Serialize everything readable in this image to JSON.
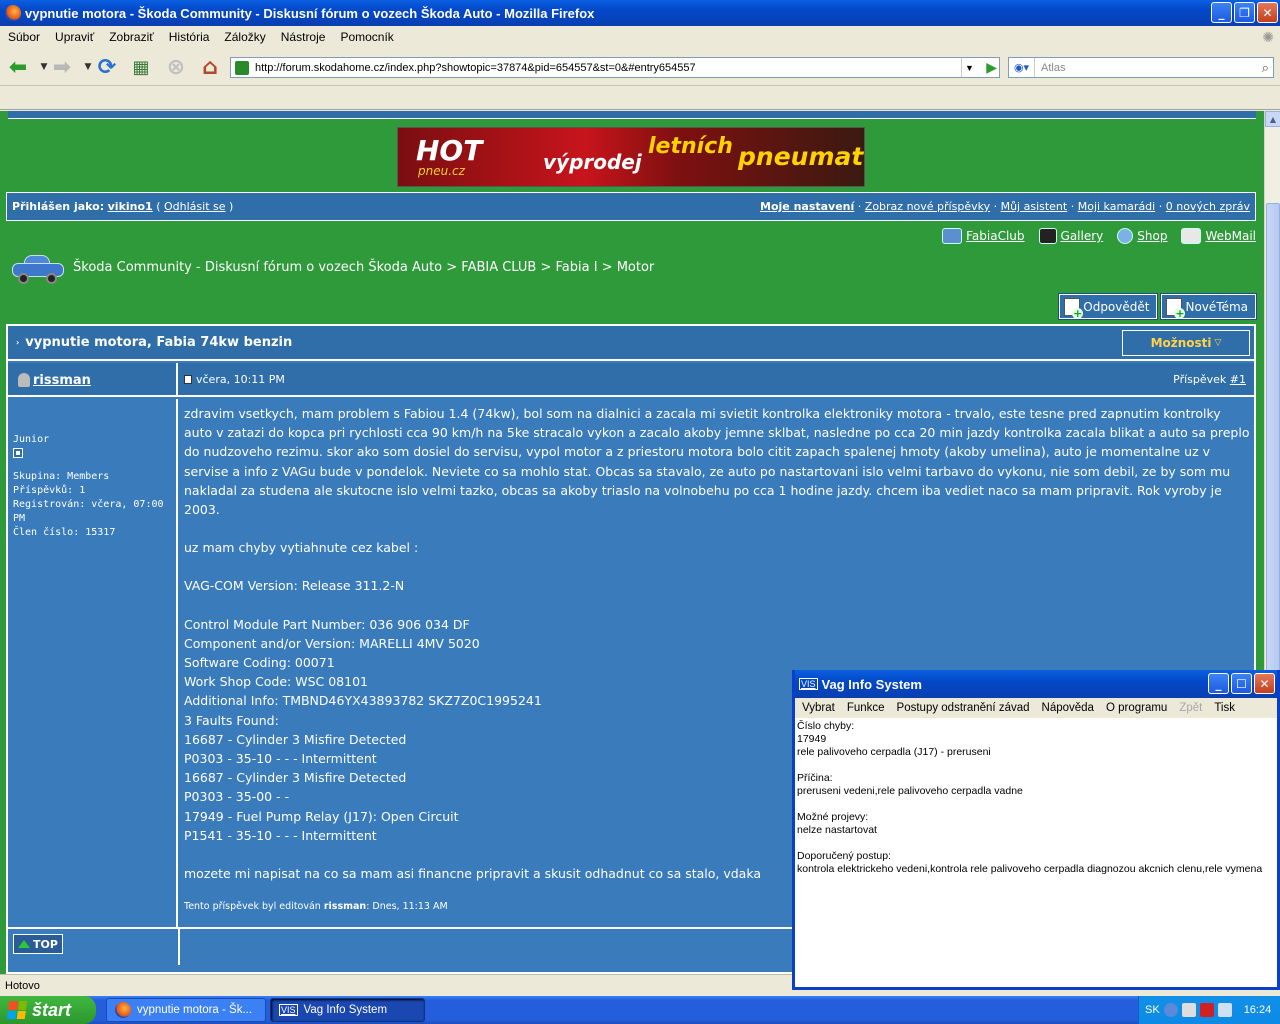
{
  "browser": {
    "title": "vypnutie motora - Škoda Community - Diskusní fórum o vozech Škoda Auto - Mozilla Firefox",
    "menu": [
      "Súbor",
      "Upraviť",
      "Zobraziť",
      "História",
      "Záložky",
      "Nástroje",
      "Pomocník"
    ],
    "url": "http://forum.skodahome.cz/index.php?showtopic=37874&pid=654557&st=0&#entry654557",
    "search_placeholder": "Atlas",
    "status": "Hotovo"
  },
  "banner": {
    "hot": "HOT",
    "pneu": "pneu.cz",
    "vyprodej": "výprodej",
    "letnich": "letních",
    "pneumatik": "pneumatik"
  },
  "login": {
    "prefix": "Přihlášen jako:",
    "user": "vikino1",
    "open": "(",
    "logout": "Odhlásit se",
    "close": ")",
    "links": [
      "Moje nastavení",
      "Zobraz nové příspěvky",
      "Můj asistent",
      "Moji kamarádi",
      "0 nových zpráv"
    ]
  },
  "quicklinks": [
    "FabiaClub",
    "Gallery",
    "Shop",
    "WebMail"
  ],
  "breadcrumb": "Škoda Community - Diskusní fórum o vozech Škoda Auto > FABIA CLUB > Fabia I > Motor",
  "actions": {
    "reply": "Odpovědět",
    "new_topic": "NovéTéma"
  },
  "topic": {
    "title": "vypnutie motora, Fabia 74kw benzin",
    "options": "Možnosti"
  },
  "post": {
    "author": "rissman",
    "date": "včera, 10:11 PM",
    "number_label": "Příspěvek",
    "number_link": "#1",
    "rank": "Junior",
    "info": [
      "Skupina: Members",
      "Příspěvků: 1",
      "Registrován: včera, 07:00 PM",
      "Člen číslo: 15317"
    ],
    "paragraphs": [
      "zdravim vsetkych, mam problem s Fabiou 1.4 (74kw), bol som na dialnici a zacala mi svietit kontrolka elektroniky motora - trvalo, este tesne pred zapnutim kontrolky auto v zatazi do kopca pri rychlosti cca 90 km/h na 5ke stracalo vykon a zacalo akoby jemne sklbat, nasledne po cca 20 min jazdy kontrolka zacala blikat a auto sa preplo do nudzoveho rezimu. skor ako som dosiel do servisu, vypol motor a z priestoru motora bolo citit zapach spalenej hmoty (akoby umelina), auto je momentalne uz v servise a info z VAGu bude v pondelok. Neviete co sa mohlo stat. Obcas sa stavalo, ze auto po nastartovani islo velmi tarbavo do vykonu, nie som debil, ze by som mu nakladal za studena ale skutocne islo velmi tazko, obcas sa akoby triaslo na volnobehu po cca 1 hodine jazdy. chcem iba vediet naco sa mam pripravit. Rok vyroby je 2003.",
      "uz mam chyby vytiahnute cez kabel :",
      "VAG-COM Version: Release 311.2-N"
    ],
    "codes": [
      "Control Module Part Number: 036 906 034 DF",
      "Component and/or Version: MARELLI 4MV 5020",
      "Software Coding: 00071",
      "Work Shop Code: WSC 08101",
      "Additional Info: TMBND46YX43893782 SKZ7Z0C1995241",
      "3 Faults Found:",
      "16687 - Cylinder 3 Misfire Detected",
      "P0303 - 35-10 - - - Intermittent",
      "16687 - Cylinder 3 Misfire Detected",
      "P0303 - 35-00 - -",
      "17949 - Fuel Pump Relay (J17): Open Circuit",
      "P1541 - 35-10 - - - Intermittent"
    ],
    "closing": "mozete mi napisat na co sa mam asi financne pripravit a skusit odhadnut co sa stalo, vdaka",
    "edited_prefix": "Tento příspěvek byl editován",
    "edited_by": "rissman",
    "edited_when": ": Dnes, 11:13 AM",
    "top_button": "TOP"
  },
  "vis": {
    "icon": "VIS",
    "title": "Vag Info System",
    "menu": [
      "Vybrat",
      "Funkce",
      "Postupy odstranění závad",
      "Nápověda",
      "O programu",
      "Zpět",
      "Tisk"
    ],
    "body": "Číslo chyby:\n17949\nrele palivoveho cerpadla (J17) - preruseni\n\nPříčina:\npreruseni vedeni,rele palivoveho cerpadla vadne\n\nMožné projevy:\nnelze nastartovat\n\nDoporučený postup:\nkontrola elektrickeho vedeni,kontrola rele palivoveho cerpadla diagnozou akcnich clenu,rele vymena"
  },
  "taskbar": {
    "start": "štart",
    "tasks": [
      "vypnutie motora - Šk...",
      "Vag Info System"
    ],
    "lang": "SK",
    "clock": "16:24"
  }
}
